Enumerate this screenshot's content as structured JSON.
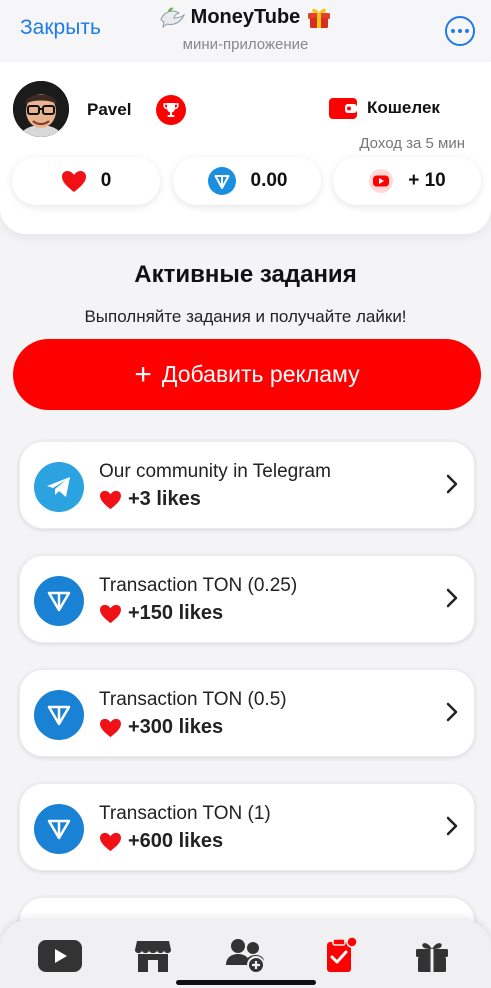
{
  "header": {
    "close_label": "Закрыть",
    "title": "MoneyTube",
    "subtitle": "мини-приложение",
    "title_icons": [
      "dove-icon",
      "gift-icon"
    ],
    "more_icon": "more-icon"
  },
  "profile": {
    "username": "Pavel",
    "wallet_label": "Кошелек",
    "income_label": "Доход за 5 мин",
    "likes_value": "0",
    "ton_value": "0.00",
    "rate_value": "+ 10"
  },
  "tasks_section": {
    "title": "Активные задания",
    "subtitle": "Выполняйте задания и получайте лайки!",
    "add_button_label": "Добавить рекламу"
  },
  "tasks": [
    {
      "title": "Our community in Telegram",
      "reward": "+3 likes",
      "icon": "telegram-icon"
    },
    {
      "title": "Transaction TON (0.25)",
      "reward": "+150 likes",
      "icon": "ton-icon"
    },
    {
      "title": "Transaction TON (0.5)",
      "reward": "+300 likes",
      "icon": "ton-icon"
    },
    {
      "title": "Transaction TON (1)",
      "reward": "+600 likes",
      "icon": "ton-icon"
    }
  ],
  "bottom_nav": [
    {
      "icon": "youtube-icon"
    },
    {
      "icon": "store-icon"
    },
    {
      "icon": "add-users-icon"
    },
    {
      "icon": "tasks-icon",
      "active": true
    },
    {
      "icon": "gift-icon"
    }
  ],
  "colors": {
    "brand_red": "#ff0000",
    "link_blue": "#1f7be6",
    "telegram_blue": "#2aa3e0",
    "ton_blue": "#1a82d4"
  }
}
